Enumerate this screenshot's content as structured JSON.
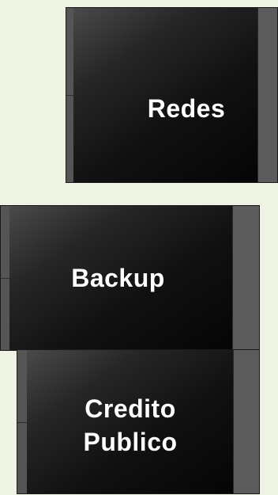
{
  "tiles": [
    {
      "id": "redes",
      "lines": [
        "Redes"
      ]
    },
    {
      "id": "backup",
      "lines": [
        "Backup"
      ]
    },
    {
      "id": "credito-publico",
      "lines": [
        "Credito",
        "Publico"
      ]
    }
  ],
  "colors": {
    "background": "#eef3e4",
    "tile_face": "#111111",
    "tile_strip": "#555555",
    "label_text": "#ffffff"
  }
}
